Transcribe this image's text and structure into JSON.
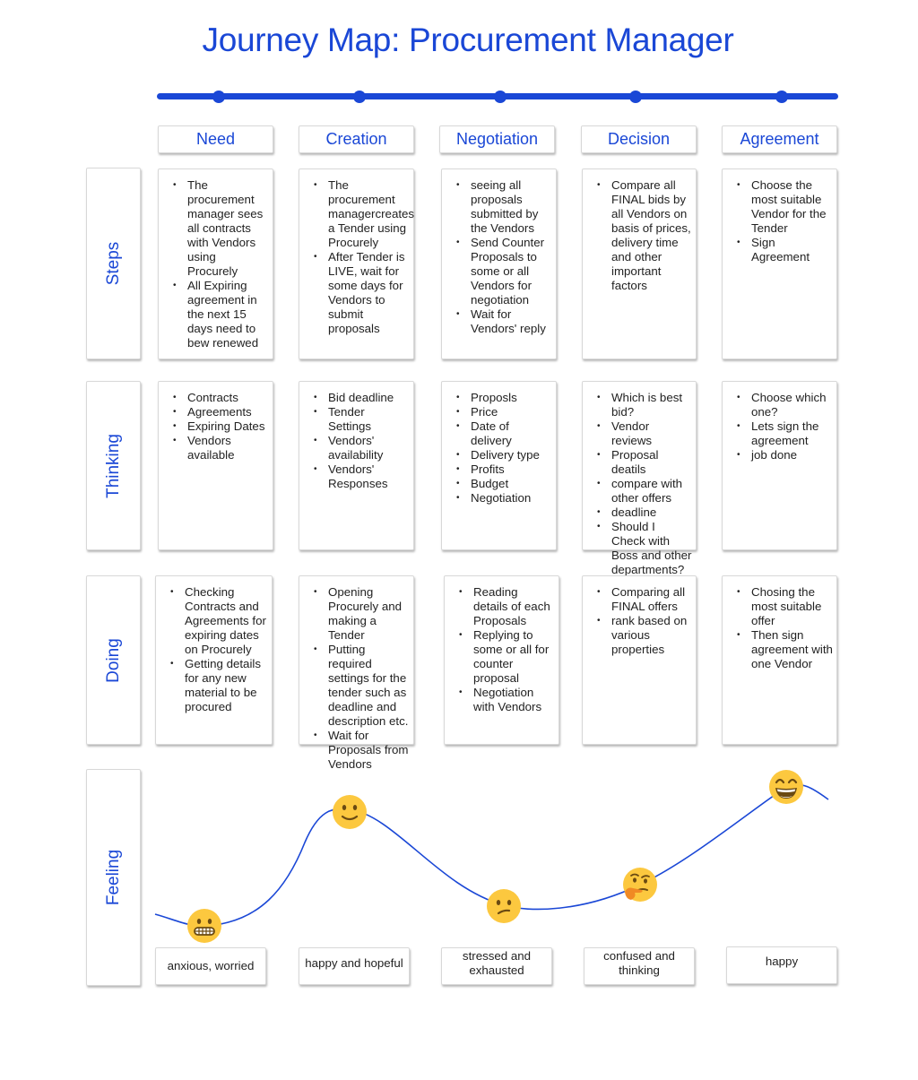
{
  "title": "Journey Map: Procurement Manager",
  "colors": {
    "accent": "#1a47d6",
    "emoji": "#fcc83f",
    "emoji_feature": "#6a4a12",
    "hand": "#f08a24"
  },
  "stages": [
    "Need",
    "Creation",
    "Negotiation",
    "Decision",
    "Agreement"
  ],
  "rows": {
    "steps": {
      "label": "Steps",
      "cells": [
        [
          "The procurement manager sees all contracts with Vendors using Procurely",
          "All Expiring agreement in the next 15 days need to bew renewed"
        ],
        [
          "The procurement managercreates a Tender using Procurely",
          "After Tender is LIVE, wait for some days for Vendors to submit proposals"
        ],
        [
          "seeing all proposals submitted by the Vendors",
          "Send Counter Proposals to some or all Vendors for negotiation",
          "Wait for Vendors' reply"
        ],
        [
          "Compare all FINAL bids by all Vendors on basis of prices, delivery time and other important factors"
        ],
        [
          "Choose  the most suitable Vendor for the Tender",
          "Sign Agreement"
        ]
      ]
    },
    "thinking": {
      "label": "Thinking",
      "cells": [
        [
          "Contracts",
          "Agreements",
          "Expiring Dates",
          "Vendors available"
        ],
        [
          "Bid deadline",
          "Tender Settings",
          "Vendors' availability",
          "Vendors' Responses"
        ],
        [
          "Proposls",
          "Price",
          "Date of delivery",
          "Delivery type",
          "Profits",
          "Budget",
          "Negotiation"
        ],
        [
          "Which is best bid?",
          "Vendor reviews",
          "Proposal deatils",
          "compare with other offers",
          "deadline",
          "Should I Check with Boss and other departments?"
        ],
        [
          "Choose which one?",
          "Lets sign the agreement",
          "job done"
        ]
      ]
    },
    "doing": {
      "label": "Doing",
      "cells": [
        [
          "Checking Contracts and Agreements for expiring dates on Procurely",
          "Getting details for any new material to be procured"
        ],
        [
          "Opening Procurely and making a Tender",
          "Putting required settings for the tender such as deadline and description etc.",
          "Wait for Proposals from Vendors"
        ],
        [
          "Reading details of each Proposals",
          "Replying to some or all for counter proposal",
          "Negotiation with Vendors"
        ],
        [
          "Comparing all FINAL offers",
          "rank based on various properties"
        ],
        [
          "Chosing the most suitable offer",
          "Then sign agreement with one Vendor"
        ]
      ]
    },
    "feeling": {
      "label": "Feeling",
      "items": [
        {
          "text": "anxious, worried",
          "emoji": "grimacing-face",
          "level": 0.05
        },
        {
          "text": "happy and hopeful",
          "emoji": "slightly-smiling-face",
          "level": 0.85
        },
        {
          "text": "stressed and exhausted",
          "emoji": "confused-face",
          "level": 0.2
        },
        {
          "text": "confused and thinking",
          "emoji": "thinking-face",
          "level": 0.4
        },
        {
          "text": "happy",
          "emoji": "grinning-face-smiling-eyes",
          "level": 0.95
        }
      ]
    }
  }
}
